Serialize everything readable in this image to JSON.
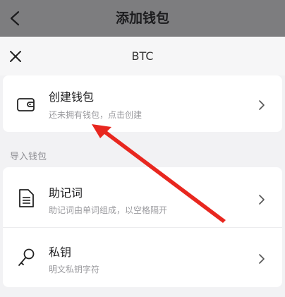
{
  "navbar": {
    "title": "添加钱包"
  },
  "sheet": {
    "title": "BTC"
  },
  "create": {
    "title": "创建钱包",
    "subtitle": "还未拥有钱包，点击创建"
  },
  "import": {
    "section_label": "导入钱包",
    "items": [
      {
        "title": "助记词",
        "subtitle": "助记词由单词组成，以空格隔开"
      },
      {
        "title": "私钥",
        "subtitle": "明文私钥字符"
      }
    ]
  },
  "annotation": {
    "arrow_color": "#e8271f"
  }
}
